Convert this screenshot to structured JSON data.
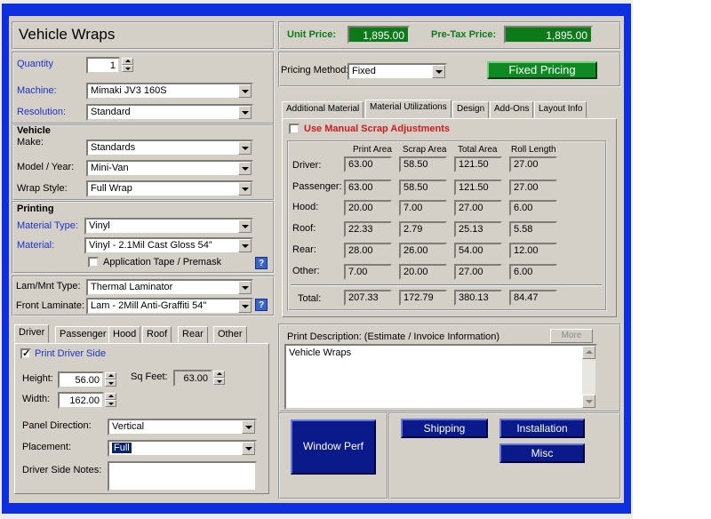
{
  "title": "Vehicle Wraps",
  "quantity": {
    "label": "Quantity",
    "value": "1"
  },
  "machine": {
    "label": "Machine:",
    "value": "Mimaki JV3 160S"
  },
  "resolution": {
    "label": "Resolution:",
    "value": "Standard"
  },
  "vehicle": {
    "heading": "Vehicle",
    "make": {
      "label": "Make:",
      "value": "Standards"
    },
    "model": {
      "label": "Model / Year:",
      "value": "Mini-Van"
    },
    "wrap_style": {
      "label": "Wrap Style:",
      "value": "Full Wrap"
    }
  },
  "printing": {
    "heading": "Printing",
    "material_type": {
      "label": "Material Type:",
      "value": "Vinyl"
    },
    "material": {
      "label": "Material:",
      "value": "Vinyl - 2.1Mil Cast Gloss 54\""
    },
    "app_tape": "Application Tape / Premask",
    "help": "?"
  },
  "lamination": {
    "lam_type": {
      "label": "Lam/Mnt Type:",
      "value": "Thermal Laminator"
    },
    "front": {
      "label": "Front Laminate:",
      "value": "Lam - 2Mill Anti-Graffiti 54\""
    },
    "help": "?"
  },
  "side_tabs": [
    "Driver",
    "Passenger",
    "Hood",
    "Roof",
    "Rear",
    "Other"
  ],
  "driver_panel": {
    "print_side": "Print Driver Side",
    "height": {
      "label": "Height:",
      "value": "56.00"
    },
    "sqfeet": {
      "label": "Sq Feet:",
      "value": "63.00"
    },
    "width": {
      "label": "Width:",
      "value": "162.00"
    },
    "panel_direction": {
      "label": "Panel Direction:",
      "value": "Vertical"
    },
    "placement": {
      "label": "Placement:",
      "value": "Full"
    },
    "notes_label": "Driver Side Notes:"
  },
  "pricing": {
    "unit_label": "Unit Price:",
    "unit_value": "1,895.00",
    "pretax_label": "Pre-Tax Price:",
    "pretax_value": "1,895.00",
    "method_label": "Pricing Method:",
    "method_value": "Fixed",
    "fixed_button": "Fixed Pricing"
  },
  "main_tabs": [
    "Additional Material",
    "Material Utilizations",
    "Design",
    "Add-Ons",
    "Layout Info"
  ],
  "material_util": {
    "manual_scrap": "Use Manual Scrap Adjustments",
    "headers": [
      "Print Area",
      "Scrap Area",
      "Total Area",
      "Roll Length"
    ],
    "rows": [
      {
        "label": "Driver:",
        "values": [
          "63.00",
          "58.50",
          "121.50",
          "27.00"
        ]
      },
      {
        "label": "Passenger:",
        "values": [
          "63.00",
          "58.50",
          "121.50",
          "27.00"
        ]
      },
      {
        "label": "Hood:",
        "values": [
          "20.00",
          "7.00",
          "27.00",
          "6.00"
        ]
      },
      {
        "label": "Roof:",
        "values": [
          "22.33",
          "2.79",
          "25.13",
          "5.58"
        ]
      },
      {
        "label": "Rear:",
        "values": [
          "28.00",
          "26.00",
          "54.00",
          "12.00"
        ]
      },
      {
        "label": "Other:",
        "values": [
          "7.00",
          "20.00",
          "27.00",
          "6.00"
        ]
      }
    ],
    "total": {
      "label": "Total:",
      "values": [
        "207.33",
        "172.79",
        "380.13",
        "84.47"
      ]
    }
  },
  "print_description": {
    "label": "Print Description: (Estimate / Invoice Information)",
    "more": "More",
    "text": "Vehicle Wraps"
  },
  "buttons": {
    "window_perf": "Window Perf",
    "shipping": "Shipping",
    "installation": "Installation",
    "misc": "Misc"
  },
  "colors": {
    "blue_frame": "#0d2fe0",
    "price_green": "#0d7a1a",
    "navy_button": "#0a1a8a",
    "accent_blue_label": "#1d33c9",
    "red_label": "#d01c1c"
  }
}
